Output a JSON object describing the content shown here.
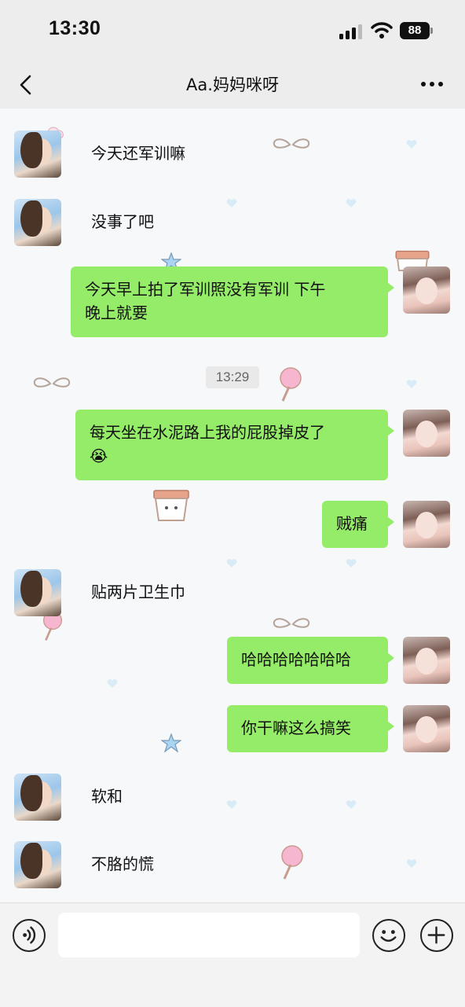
{
  "status_bar": {
    "time": "13:30",
    "battery": "88"
  },
  "nav": {
    "title": "Aa.妈妈咪呀"
  },
  "messages": [
    {
      "side": "left",
      "text": "今天还军训嘛"
    },
    {
      "side": "left",
      "text": "没事了吧"
    },
    {
      "side": "right",
      "line1": "今天早上拍了军训照没有军训 下午",
      "line2": "晚上就要"
    },
    {
      "side": "right",
      "line1": "每天坐在水泥路上我的屁股掉皮了",
      "emoji": "😭"
    },
    {
      "side": "right",
      "text": "贼痛"
    },
    {
      "side": "left",
      "text": "贴两片卫生巾"
    },
    {
      "side": "right",
      "text": "哈哈哈哈哈哈哈"
    },
    {
      "side": "right",
      "text": "你干嘛这么搞笑"
    },
    {
      "side": "left",
      "text": "软和"
    },
    {
      "side": "left",
      "text": "不胳的慌"
    }
  ],
  "timestamp": "13:29",
  "input": {
    "value": "",
    "placeholder": ""
  },
  "icons": {
    "back": "chevron-left-icon",
    "more": "more-dots-icon",
    "voice": "voice-icon",
    "emoji": "smiley-icon",
    "add": "plus-icon"
  },
  "colors": {
    "bubble_right": "#95ec69",
    "background": "#ededed",
    "chat_bg": "#f7f8fa"
  }
}
